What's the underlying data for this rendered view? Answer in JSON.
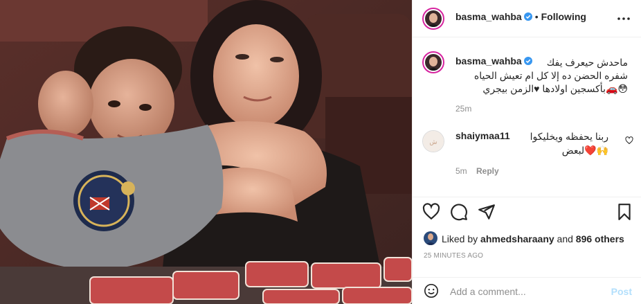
{
  "header": {
    "username": "basma_wahba",
    "separator": "•",
    "follow_status": "Following"
  },
  "caption": {
    "username": "basma_wahba",
    "lines": [
      "ماحدش حيعرف يفك",
      "شفره الحضن ده إلا كل ام تعيش الحياه",
      "😳🚗بأكسجين اولادها ♥الزمن بيجري"
    ],
    "age": "25m"
  },
  "comments": [
    {
      "username": "shaiymaa11",
      "line1": "ربنا يحفظه ويخليكوا",
      "line2": "🙌❤️لبعض",
      "age": "5m",
      "reply_label": "Reply"
    }
  ],
  "likes": {
    "prefix": "Liked by",
    "by_user": "ahmedsharaany",
    "connector": "and",
    "others": "896 others"
  },
  "timestamp": "25 MINUTES AGO",
  "composer": {
    "placeholder": "Add a comment...",
    "post_label": "Post"
  },
  "colors": {
    "verified": "#3897f0",
    "story_ring": "#d6249f",
    "post_disabled": "#b2dffc",
    "secondary_text": "#8e8e8e"
  },
  "icons": [
    "verified-badge-icon",
    "more-options-icon",
    "heart-icon",
    "comment-icon",
    "share-icon",
    "bookmark-icon",
    "emoji-icon"
  ]
}
